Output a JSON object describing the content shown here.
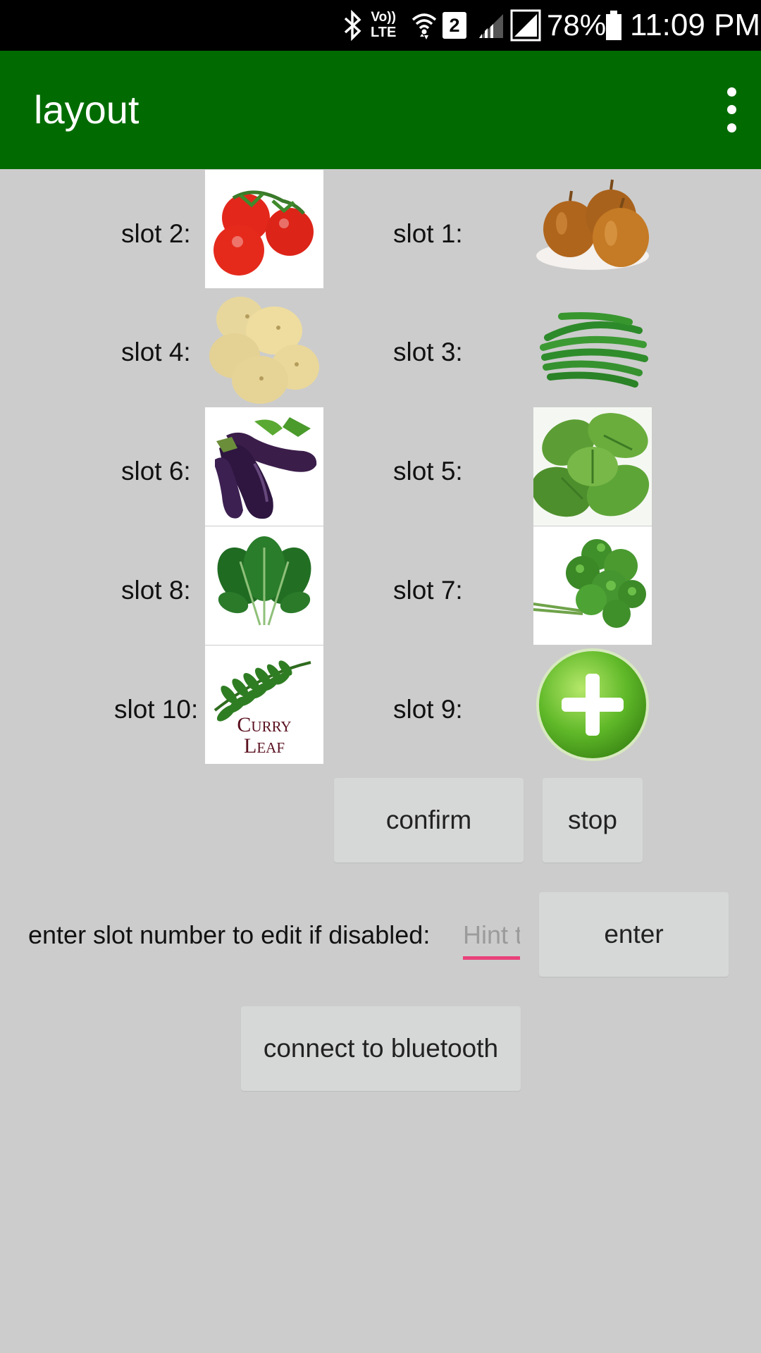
{
  "status_bar": {
    "icons": [
      "bluetooth-icon",
      "volte-icon",
      "wifi-icon",
      "sim-2-icon",
      "signal-icon",
      "signal-icon",
      "battery-icon"
    ],
    "lte_label": "LTE",
    "vo_label": "Vo))",
    "sim_label": "2",
    "battery_percent": "78%",
    "time": "11:09 PM"
  },
  "app_bar": {
    "title": "layout",
    "menu_icon": "overflow-menu-icon",
    "color": "#016b01"
  },
  "slots": {
    "slot2": {
      "label": "slot 2:",
      "image": "tomato"
    },
    "slot1": {
      "label": "slot 1:",
      "image": "onion"
    },
    "slot4": {
      "label": "slot 4:",
      "image": "potato"
    },
    "slot3": {
      "label": "slot 3:",
      "image": "green-beans"
    },
    "slot6": {
      "label": "slot 6:",
      "image": "eggplant"
    },
    "slot5": {
      "label": "slot 5:",
      "image": "mint"
    },
    "slot8": {
      "label": "slot 8:",
      "image": "spinach"
    },
    "slot7": {
      "label": "slot 7:",
      "image": "coriander"
    },
    "slot10": {
      "label": "slot 10:",
      "image": "curry-leaf",
      "image_text_1": "Curry",
      "image_text_2": "Leaf"
    },
    "slot9": {
      "label": "slot 9:",
      "image": "add-icon"
    }
  },
  "buttons": {
    "confirm": "confirm",
    "stop": "stop",
    "enter": "enter",
    "bluetooth": "connect to bluetooth"
  },
  "edit": {
    "prompt": "enter slot number to edit if disabled:",
    "placeholder": "Hint t",
    "accent": "#e9427a"
  }
}
